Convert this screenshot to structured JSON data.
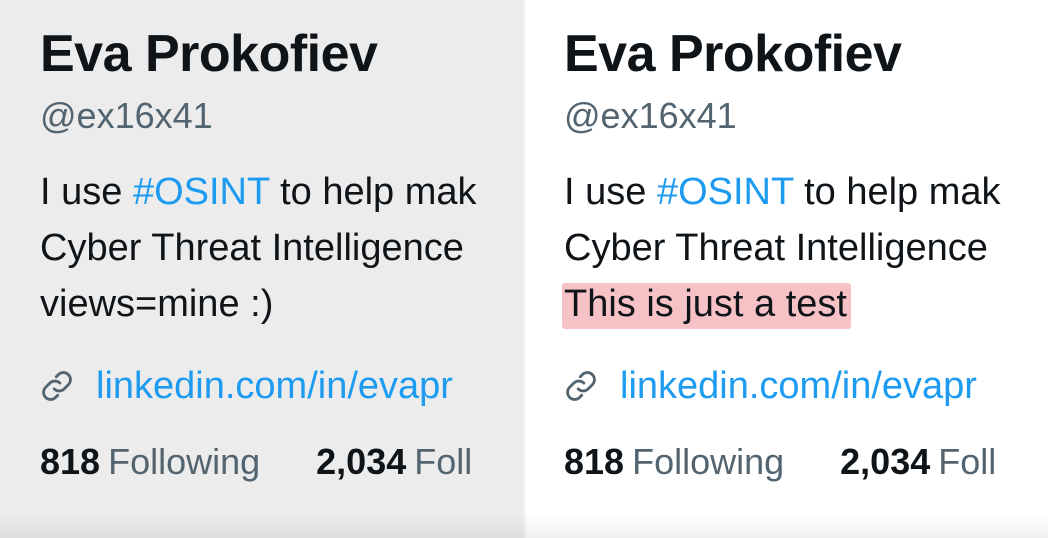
{
  "left_panel": {
    "display_name": "Eva Prokofiev",
    "handle": "@ex16x41",
    "bio": {
      "line1_prefix": "I use ",
      "line1_hashtag": "#OSINT",
      "line1_suffix": " to help mak",
      "line2": "Cyber Threat Intelligence",
      "line3": "views=mine :)"
    },
    "link_text": "linkedin.com/in/evapr",
    "stats": {
      "following_count": "818",
      "following_label": "Following",
      "followers_count": "2,034",
      "followers_label": "Foll"
    }
  },
  "right_panel": {
    "display_name": "Eva Prokofiev",
    "handle": "@ex16x41",
    "bio": {
      "line1_prefix": "I use ",
      "line1_hashtag": "#OSINT",
      "line1_suffix": " to help mak",
      "line2": "Cyber Threat Intelligence",
      "line3": "This is just a test"
    },
    "link_text": "linkedin.com/in/evapr",
    "stats": {
      "following_count": "818",
      "following_label": "Following",
      "followers_count": "2,034",
      "followers_label": "Foll"
    }
  },
  "colors": {
    "left_background": "#ececec",
    "right_background": "#ffffff",
    "text_primary": "#0f1419",
    "text_secondary": "#536471",
    "link_blue": "#1d9bf0",
    "highlight_pink": "#f7c2c5"
  },
  "icons": {
    "link": "link-icon"
  }
}
